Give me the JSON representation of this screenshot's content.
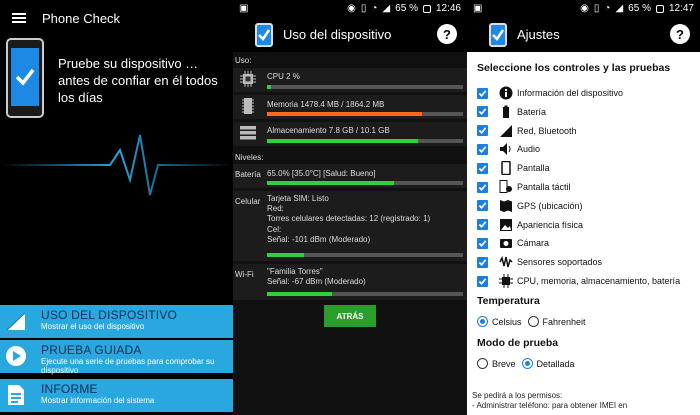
{
  "panel1": {
    "title": "Phone Check",
    "slogan": "Pruebe su dispositivo … antes de confiar en él todos los días",
    "menu": [
      {
        "title": "USO DEL DISPOSITIVO",
        "desc": "Mostrar el uso del dispositivo",
        "icon": "signal-icon"
      },
      {
        "title": "PRUEBA GUIADA",
        "desc": "Ejecute una serie de pruebas para comprobar su dispositivo",
        "icon": "play-icon"
      },
      {
        "title": "INFORME",
        "desc": "Mostrar información del sistema",
        "icon": "report-icon"
      }
    ]
  },
  "panel2": {
    "time": "12:46",
    "battery": "65 %",
    "title": "Uso del dispositivo",
    "help": "?",
    "uso_label": "Uso:",
    "cpu": {
      "text": "CPU 2 %",
      "value": 0.02
    },
    "memory": {
      "text": "Memoria 1478.4 MB / 1864.2 MB",
      "value": 0.79
    },
    "storage": {
      "text": "Almacenamiento 7.8 GB / 10.1 GB",
      "value": 0.77
    },
    "niveles_label": "Niveles:",
    "bateria": {
      "label": "Batería",
      "text": "65.0% [35.0°C] [Salud: Bueno]",
      "value": 0.65
    },
    "celular": {
      "label": "Celular",
      "lines": [
        "Tarjeta SIM: Listo",
        "Red:",
        "Torres celulares detectadas: 12 (registrado: 1)",
        "Cel:",
        "Señal: -101 dBm (Moderado)"
      ],
      "value": 0.19
    },
    "wifi": {
      "label": "Wi-Fi",
      "lines": [
        "\"Familia Torres\"",
        "Señal: -67 dBm (Moderado)"
      ],
      "value": 0.33
    },
    "atras": "ATRÁS"
  },
  "panel3": {
    "time": "12:47",
    "battery": "65 %",
    "title": "Ajustes",
    "help": "?",
    "heading": "Seleccione los controles y las pruebas",
    "items": [
      {
        "label": "Información del dispositivo",
        "icon": "info-icon"
      },
      {
        "label": "Batería",
        "icon": "battery-icon"
      },
      {
        "label": "Red, Bluetooth",
        "icon": "network-signal-icon"
      },
      {
        "label": "Audio",
        "icon": "speaker-icon"
      },
      {
        "label": "Pantalla",
        "icon": "screen-icon"
      },
      {
        "label": "Pantalla táctil",
        "icon": "touch-icon"
      },
      {
        "label": "GPS (ubicación)",
        "icon": "map-icon"
      },
      {
        "label": "Apariencia física",
        "icon": "image-icon"
      },
      {
        "label": "Cámara",
        "icon": "camera-icon"
      },
      {
        "label": "Sensores soportados",
        "icon": "sensor-icon"
      },
      {
        "label": "CPU, memoria, almacenamiento, batería",
        "icon": "chip-icon"
      }
    ],
    "temp_heading": "Temperatura",
    "temp_options": [
      "Celsius",
      "Fahrenheit"
    ],
    "mode_heading": "Modo de prueba",
    "mode_options": [
      "Breve",
      "Detallada"
    ],
    "permissions": [
      "Se pedirá a los permisos:",
      "- Administrar teléfono: para obtener IMEI en"
    ]
  },
  "colors": {
    "accent": "#29a8e0",
    "bar_green": "#2ed23a",
    "bar_orange": "#ff6a1a",
    "checkbox": "#1e7ee0",
    "atras_button": "#2a9d2a"
  }
}
